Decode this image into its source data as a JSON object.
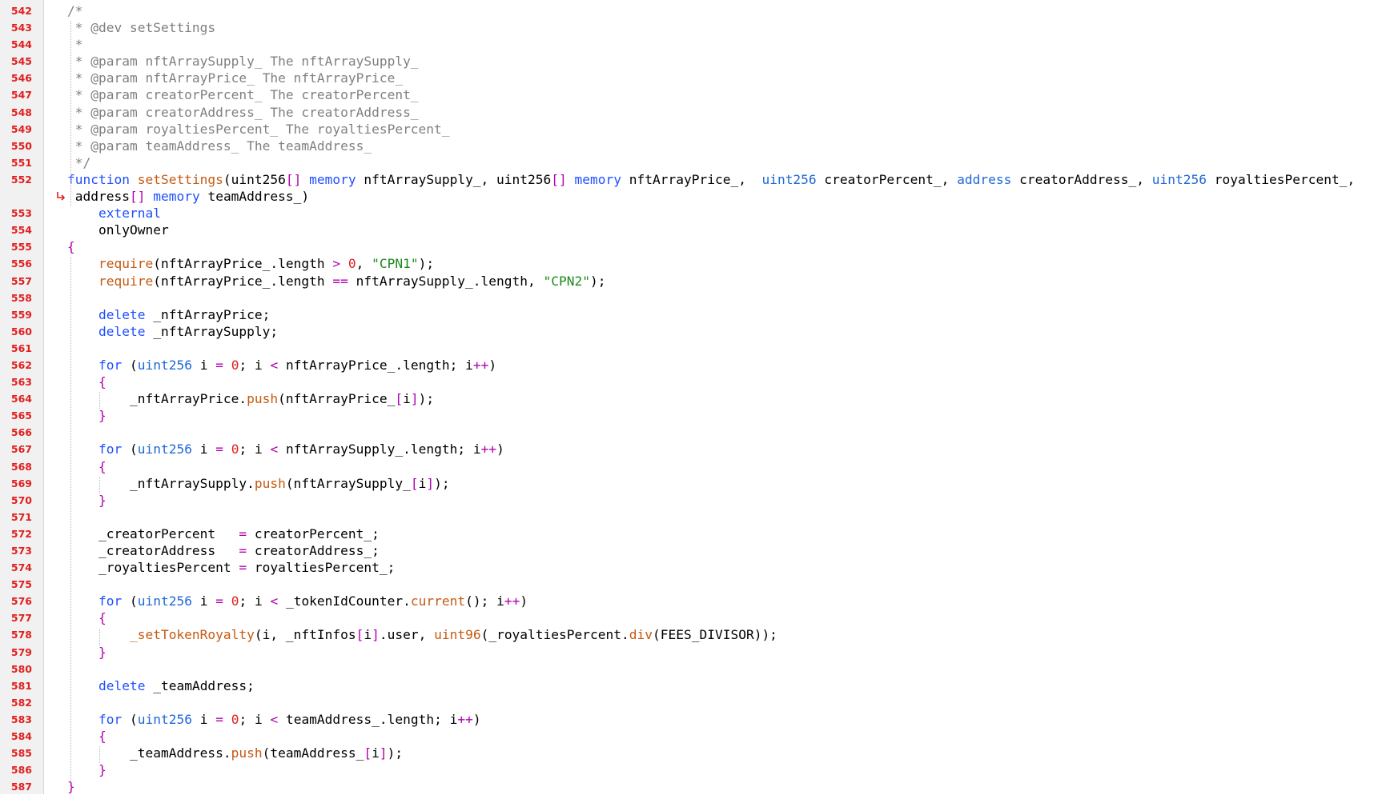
{
  "colors": {
    "line_number": "#e0201f",
    "comment": "#808080",
    "keyword": "#1f4fff",
    "type": "#1f67d6",
    "function_name": "#c55a11",
    "string": "#1a8a1a",
    "number": "#e0201f",
    "operator": "#b000b0",
    "gutter_background": "#f1f1f1",
    "editor_background": "#ffffff"
  },
  "code": {
    "lines": [
      {
        "num": "542",
        "tokens": [
          {
            "t": "/*",
            "c": "c"
          }
        ]
      },
      {
        "num": "543",
        "tokens": [
          {
            "t": " * @dev setSettings",
            "c": "c"
          }
        ]
      },
      {
        "num": "544",
        "tokens": [
          {
            "t": " *",
            "c": "c"
          }
        ]
      },
      {
        "num": "545",
        "tokens": [
          {
            "t": " * @param nftArraySupply_ The nftArraySupply_",
            "c": "c"
          }
        ]
      },
      {
        "num": "546",
        "tokens": [
          {
            "t": " * @param nftArrayPrice_ The nftArrayPrice_",
            "c": "c"
          }
        ]
      },
      {
        "num": "547",
        "tokens": [
          {
            "t": " * @param creatorPercent_ The creatorPercent_",
            "c": "c"
          }
        ]
      },
      {
        "num": "548",
        "tokens": [
          {
            "t": " * @param creatorAddress_ The creatorAddress_",
            "c": "c"
          }
        ]
      },
      {
        "num": "549",
        "tokens": [
          {
            "t": " * @param royaltiesPercent_ The royaltiesPercent_",
            "c": "c"
          }
        ]
      },
      {
        "num": "550",
        "tokens": [
          {
            "t": " * @param teamAddress_ The teamAddress_",
            "c": "c"
          }
        ]
      },
      {
        "num": "551",
        "tokens": [
          {
            "t": " */",
            "c": "c"
          }
        ]
      },
      {
        "num": "552",
        "tokens": [
          {
            "t": "function ",
            "c": "kw"
          },
          {
            "t": "setSettings",
            "c": "fn"
          },
          {
            "t": "(uint256",
            "c": "pl"
          },
          {
            "t": "[]",
            "c": "op"
          },
          {
            "t": " memory",
            "c": "kw"
          },
          {
            "t": " nftArraySupply_, uint256",
            "c": "pl"
          },
          {
            "t": "[]",
            "c": "op"
          },
          {
            "t": " memory",
            "c": "kw"
          },
          {
            "t": " nftArrayPrice_,  ",
            "c": "pl"
          },
          {
            "t": "uint256",
            "c": "ty"
          },
          {
            "t": " creatorPercent_, ",
            "c": "pl"
          },
          {
            "t": "address",
            "c": "ty"
          },
          {
            "t": " creatorAddress_, ",
            "c": "pl"
          },
          {
            "t": "uint256",
            "c": "ty"
          },
          {
            "t": " royaltiesPercent_,",
            "c": "pl"
          }
        ]
      },
      {
        "num": "",
        "wrap": true,
        "tokens": [
          {
            "t": " address",
            "c": "pl"
          },
          {
            "t": "[]",
            "c": "op"
          },
          {
            "t": " memory",
            "c": "kw"
          },
          {
            "t": " teamAddress_)",
            "c": "pl"
          }
        ]
      },
      {
        "num": "553",
        "tokens": [
          {
            "t": "    external",
            "c": "kw"
          }
        ]
      },
      {
        "num": "554",
        "tokens": [
          {
            "t": "    onlyOwner",
            "c": "pl"
          }
        ]
      },
      {
        "num": "555",
        "tokens": [
          {
            "t": "{",
            "c": "op"
          }
        ]
      },
      {
        "num": "556",
        "tokens": [
          {
            "t": "    require",
            "c": "fn"
          },
          {
            "t": "(nftArrayPrice_.length ",
            "c": "pl"
          },
          {
            "t": ">",
            "c": "op"
          },
          {
            "t": " 0",
            "c": "nm"
          },
          {
            "t": ", ",
            "c": "pl"
          },
          {
            "t": "\"CPN1\"",
            "c": "st"
          },
          {
            "t": ");",
            "c": "pl"
          }
        ]
      },
      {
        "num": "557",
        "tokens": [
          {
            "t": "    require",
            "c": "fn"
          },
          {
            "t": "(nftArrayPrice_.length ",
            "c": "pl"
          },
          {
            "t": "==",
            "c": "op"
          },
          {
            "t": " nftArraySupply_.length, ",
            "c": "pl"
          },
          {
            "t": "\"CPN2\"",
            "c": "st"
          },
          {
            "t": ");",
            "c": "pl"
          }
        ]
      },
      {
        "num": "558",
        "tokens": []
      },
      {
        "num": "559",
        "tokens": [
          {
            "t": "    delete",
            "c": "kw"
          },
          {
            "t": " _nftArrayPrice;",
            "c": "pl"
          }
        ]
      },
      {
        "num": "560",
        "tokens": [
          {
            "t": "    delete",
            "c": "kw"
          },
          {
            "t": " _nftArraySupply;",
            "c": "pl"
          }
        ]
      },
      {
        "num": "561",
        "tokens": []
      },
      {
        "num": "562",
        "tokens": [
          {
            "t": "    for",
            "c": "kw"
          },
          {
            "t": " (",
            "c": "pl"
          },
          {
            "t": "uint256",
            "c": "ty"
          },
          {
            "t": " i ",
            "c": "pl"
          },
          {
            "t": "=",
            "c": "op"
          },
          {
            "t": " 0",
            "c": "nm"
          },
          {
            "t": "; i ",
            "c": "pl"
          },
          {
            "t": "<",
            "c": "op"
          },
          {
            "t": " nftArrayPrice_.length; i",
            "c": "pl"
          },
          {
            "t": "++",
            "c": "op"
          },
          {
            "t": ")",
            "c": "pl"
          }
        ]
      },
      {
        "num": "563",
        "tokens": [
          {
            "t": "    {",
            "c": "op"
          }
        ]
      },
      {
        "num": "564",
        "tokens": [
          {
            "t": "        _nftArrayPrice.",
            "c": "pl"
          },
          {
            "t": "push",
            "c": "fn"
          },
          {
            "t": "(nftArrayPrice_",
            "c": "pl"
          },
          {
            "t": "[",
            "c": "op"
          },
          {
            "t": "i",
            "c": "pl"
          },
          {
            "t": "]",
            "c": "op"
          },
          {
            "t": ");",
            "c": "pl"
          }
        ]
      },
      {
        "num": "565",
        "tokens": [
          {
            "t": "    }",
            "c": "op"
          }
        ]
      },
      {
        "num": "566",
        "tokens": []
      },
      {
        "num": "567",
        "tokens": [
          {
            "t": "    for",
            "c": "kw"
          },
          {
            "t": " (",
            "c": "pl"
          },
          {
            "t": "uint256",
            "c": "ty"
          },
          {
            "t": " i ",
            "c": "pl"
          },
          {
            "t": "=",
            "c": "op"
          },
          {
            "t": " 0",
            "c": "nm"
          },
          {
            "t": "; i ",
            "c": "pl"
          },
          {
            "t": "<",
            "c": "op"
          },
          {
            "t": " nftArraySupply_.length; i",
            "c": "pl"
          },
          {
            "t": "++",
            "c": "op"
          },
          {
            "t": ")",
            "c": "pl"
          }
        ]
      },
      {
        "num": "568",
        "tokens": [
          {
            "t": "    {",
            "c": "op"
          }
        ]
      },
      {
        "num": "569",
        "tokens": [
          {
            "t": "        _nftArraySupply.",
            "c": "pl"
          },
          {
            "t": "push",
            "c": "fn"
          },
          {
            "t": "(nftArraySupply_",
            "c": "pl"
          },
          {
            "t": "[",
            "c": "op"
          },
          {
            "t": "i",
            "c": "pl"
          },
          {
            "t": "]",
            "c": "op"
          },
          {
            "t": ");",
            "c": "pl"
          }
        ]
      },
      {
        "num": "570",
        "tokens": [
          {
            "t": "    }",
            "c": "op"
          }
        ]
      },
      {
        "num": "571",
        "tokens": []
      },
      {
        "num": "572",
        "tokens": [
          {
            "t": "    _creatorPercent   ",
            "c": "pl"
          },
          {
            "t": "=",
            "c": "op"
          },
          {
            "t": " creatorPercent_;",
            "c": "pl"
          }
        ]
      },
      {
        "num": "573",
        "tokens": [
          {
            "t": "    _creatorAddress   ",
            "c": "pl"
          },
          {
            "t": "=",
            "c": "op"
          },
          {
            "t": " creatorAddress_;",
            "c": "pl"
          }
        ]
      },
      {
        "num": "574",
        "tokens": [
          {
            "t": "    _royaltiesPercent ",
            "c": "pl"
          },
          {
            "t": "=",
            "c": "op"
          },
          {
            "t": " royaltiesPercent_;",
            "c": "pl"
          }
        ]
      },
      {
        "num": "575",
        "tokens": []
      },
      {
        "num": "576",
        "tokens": [
          {
            "t": "    for",
            "c": "kw"
          },
          {
            "t": " (",
            "c": "pl"
          },
          {
            "t": "uint256",
            "c": "ty"
          },
          {
            "t": " i ",
            "c": "pl"
          },
          {
            "t": "=",
            "c": "op"
          },
          {
            "t": " 0",
            "c": "nm"
          },
          {
            "t": "; i ",
            "c": "pl"
          },
          {
            "t": "<",
            "c": "op"
          },
          {
            "t": " _tokenIdCounter.",
            "c": "pl"
          },
          {
            "t": "current",
            "c": "fn"
          },
          {
            "t": "(); i",
            "c": "pl"
          },
          {
            "t": "++",
            "c": "op"
          },
          {
            "t": ")",
            "c": "pl"
          }
        ]
      },
      {
        "num": "577",
        "tokens": [
          {
            "t": "    {",
            "c": "op"
          }
        ]
      },
      {
        "num": "578",
        "tokens": [
          {
            "t": "        _setTokenRoyalty",
            "c": "fn"
          },
          {
            "t": "(i, _nftInfos",
            "c": "pl"
          },
          {
            "t": "[",
            "c": "op"
          },
          {
            "t": "i",
            "c": "pl"
          },
          {
            "t": "]",
            "c": "op"
          },
          {
            "t": ".user, ",
            "c": "pl"
          },
          {
            "t": "uint96",
            "c": "fn"
          },
          {
            "t": "(_royaltiesPercent.",
            "c": "pl"
          },
          {
            "t": "div",
            "c": "fn"
          },
          {
            "t": "(FEES_DIVISOR));",
            "c": "pl"
          }
        ]
      },
      {
        "num": "579",
        "tokens": [
          {
            "t": "    }",
            "c": "op"
          }
        ]
      },
      {
        "num": "580",
        "tokens": []
      },
      {
        "num": "581",
        "tokens": [
          {
            "t": "    delete",
            "c": "kw"
          },
          {
            "t": " _teamAddress;",
            "c": "pl"
          }
        ]
      },
      {
        "num": "582",
        "tokens": []
      },
      {
        "num": "583",
        "tokens": [
          {
            "t": "    for",
            "c": "kw"
          },
          {
            "t": " (",
            "c": "pl"
          },
          {
            "t": "uint256",
            "c": "ty"
          },
          {
            "t": " i ",
            "c": "pl"
          },
          {
            "t": "=",
            "c": "op"
          },
          {
            "t": " 0",
            "c": "nm"
          },
          {
            "t": "; i ",
            "c": "pl"
          },
          {
            "t": "<",
            "c": "op"
          },
          {
            "t": " teamAddress_.length; i",
            "c": "pl"
          },
          {
            "t": "++",
            "c": "op"
          },
          {
            "t": ")",
            "c": "pl"
          }
        ]
      },
      {
        "num": "584",
        "tokens": [
          {
            "t": "    {",
            "c": "op"
          }
        ]
      },
      {
        "num": "585",
        "tokens": [
          {
            "t": "        _teamAddress.",
            "c": "pl"
          },
          {
            "t": "push",
            "c": "fn"
          },
          {
            "t": "(teamAddress_",
            "c": "pl"
          },
          {
            "t": "[",
            "c": "op"
          },
          {
            "t": "i",
            "c": "pl"
          },
          {
            "t": "]",
            "c": "op"
          },
          {
            "t": ");",
            "c": "pl"
          }
        ]
      },
      {
        "num": "586",
        "tokens": [
          {
            "t": "    }",
            "c": "op"
          }
        ]
      },
      {
        "num": "587",
        "tokens": [
          {
            "t": "}",
            "c": "op"
          }
        ]
      }
    ]
  },
  "icons": {
    "wrap": "line-wrap-icon"
  }
}
